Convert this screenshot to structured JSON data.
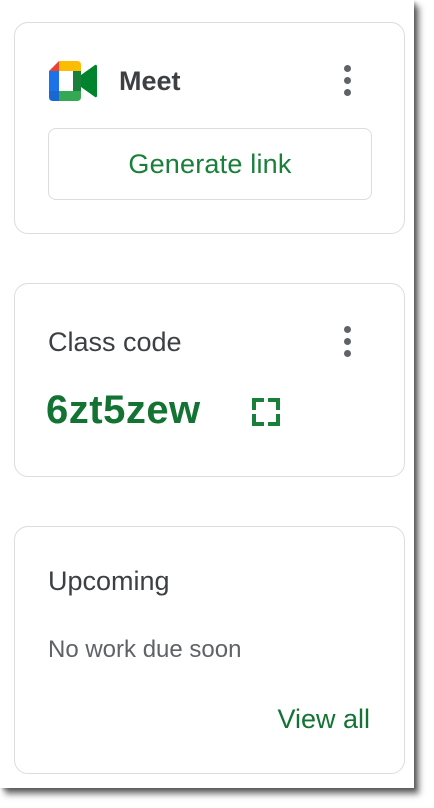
{
  "meet_card": {
    "title": "Meet",
    "logo_icon": "google-meet-logo",
    "more_icon": "more-vert-icon",
    "generate_link_label": "Generate link"
  },
  "class_code_card": {
    "title": "Class code",
    "code": "6zt5zew",
    "display_icon": "fullscreen-icon",
    "more_icon": "more-vert-icon"
  },
  "upcoming_card": {
    "title": "Upcoming",
    "empty_message": "No work due soon",
    "view_all_label": "View all"
  },
  "colors": {
    "accent_green": "#188038",
    "code_green": "#137333",
    "text_primary": "#3c4043",
    "text_secondary": "#5f6368",
    "border": "#dadce0"
  }
}
